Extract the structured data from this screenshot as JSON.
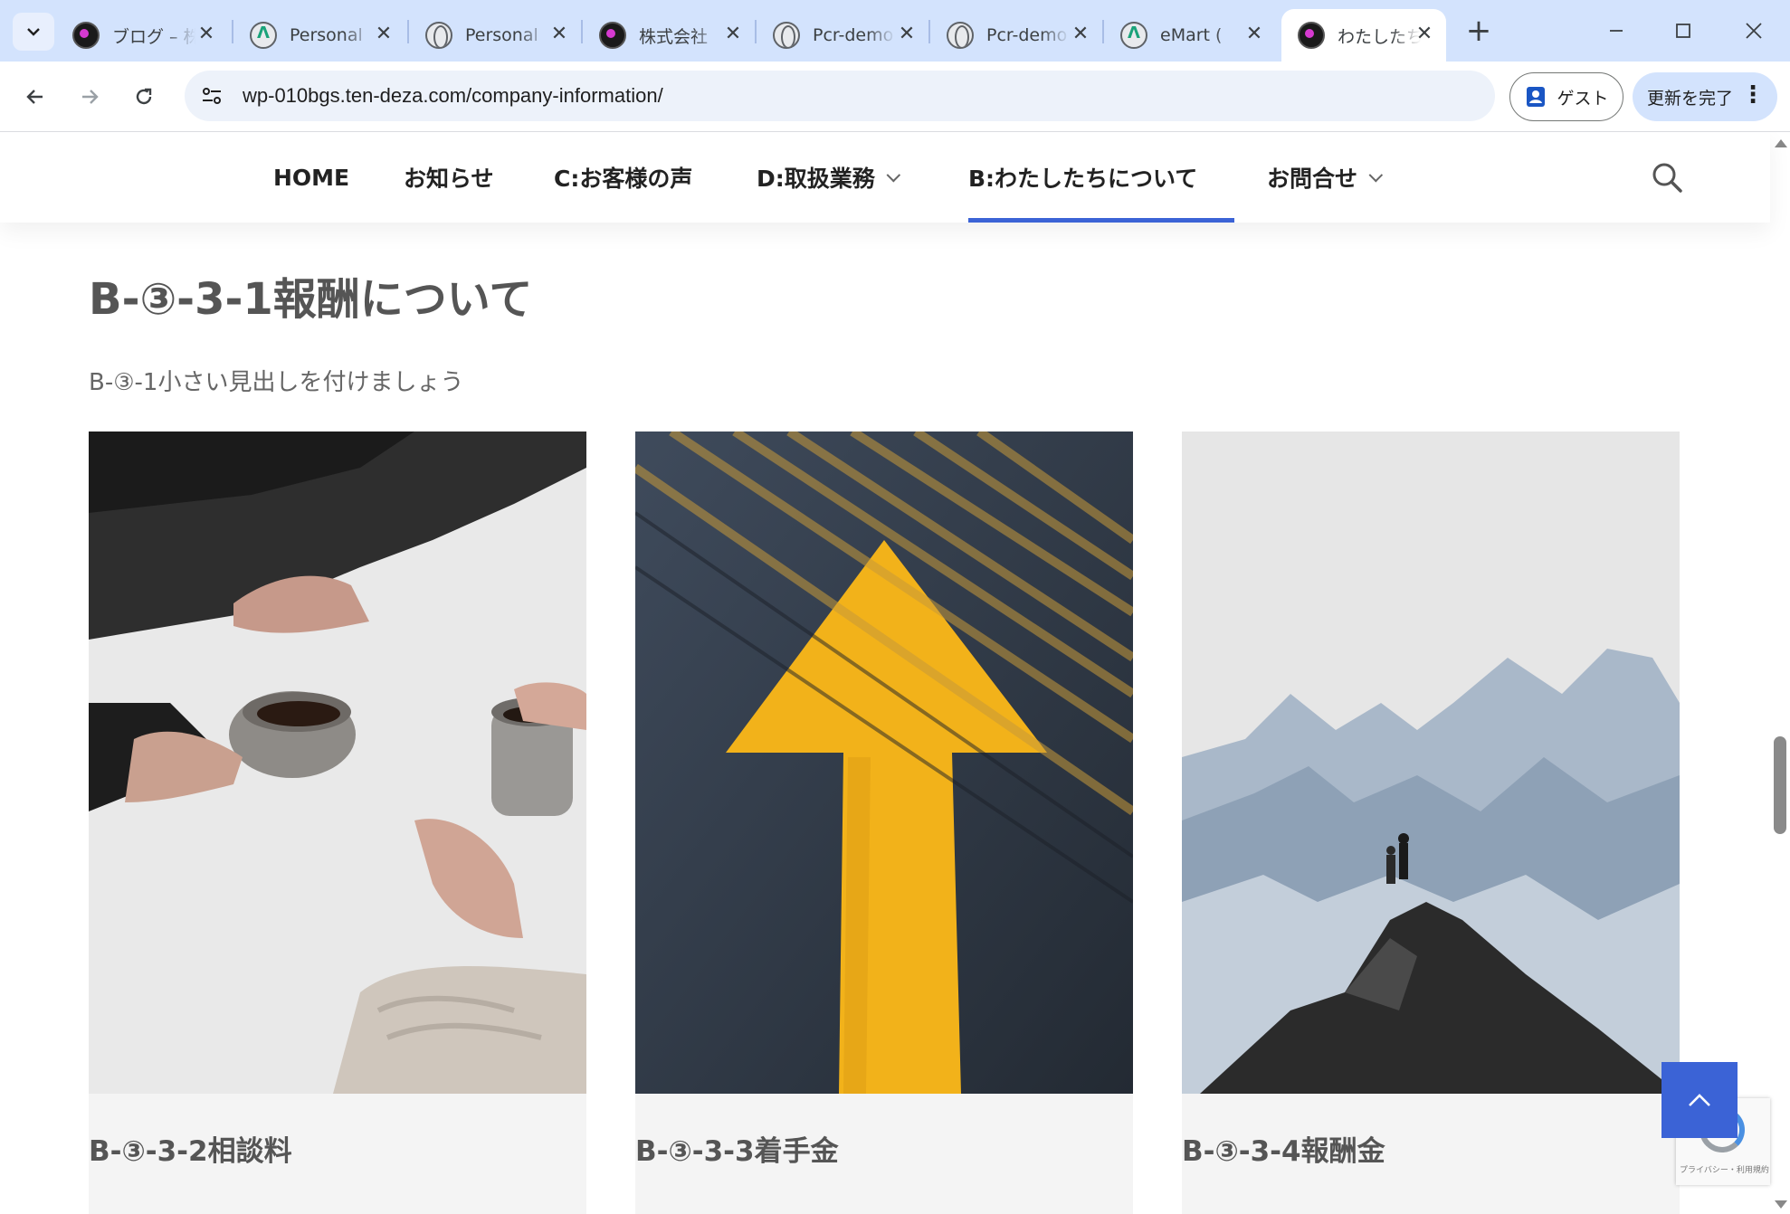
{
  "browser": {
    "tabs": [
      {
        "title": "ブログ – 株",
        "favicon": "dark-logo",
        "active": false
      },
      {
        "title": "Personal",
        "favicon": "green-a-logo",
        "active": false
      },
      {
        "title": "Personal",
        "favicon": "globe",
        "active": false
      },
      {
        "title": "株式会社",
        "favicon": "dark-logo",
        "active": false
      },
      {
        "title": "Pcr-demo",
        "favicon": "globe",
        "active": false
      },
      {
        "title": "Pcr-demo",
        "favicon": "globe",
        "active": false
      },
      {
        "title": "eMart (",
        "favicon": "green-a-logo",
        "active": false
      },
      {
        "title": "わたしたち",
        "favicon": "dark-logo",
        "active": true
      }
    ],
    "url": "wp-010bgs.ten-deza.com/company-information/",
    "guest_label": "ゲスト",
    "update_label": "更新を完了"
  },
  "site": {
    "menu": [
      {
        "label": "HOME",
        "has_dropdown": false,
        "active": false
      },
      {
        "label": "お知らせ",
        "has_dropdown": false,
        "active": false
      },
      {
        "label": "C:お客様の声",
        "has_dropdown": false,
        "active": false
      },
      {
        "label": "D:取扱業務",
        "has_dropdown": true,
        "active": false
      },
      {
        "label": "B:わたしたちについて",
        "has_dropdown": false,
        "active": true
      },
      {
        "label": "お問合せ",
        "has_dropdown": true,
        "active": false
      }
    ],
    "accent_color": "#3b63d6"
  },
  "content": {
    "section_title": "B-③-3-1報酬について",
    "section_subtitle": "B-③-1小さい見出しを付けましょう",
    "cards": [
      {
        "caption": "B-③-3-2相談料",
        "image": "coffee-meeting-photo"
      },
      {
        "caption": "B-③-3-3着手金",
        "image": "yellow-arrow-road-photo"
      },
      {
        "caption": "B-③-3-4報酬金",
        "image": "mountain-summit-photo"
      }
    ]
  },
  "recaptcha": {
    "text": "プライバシー・利用規約"
  }
}
